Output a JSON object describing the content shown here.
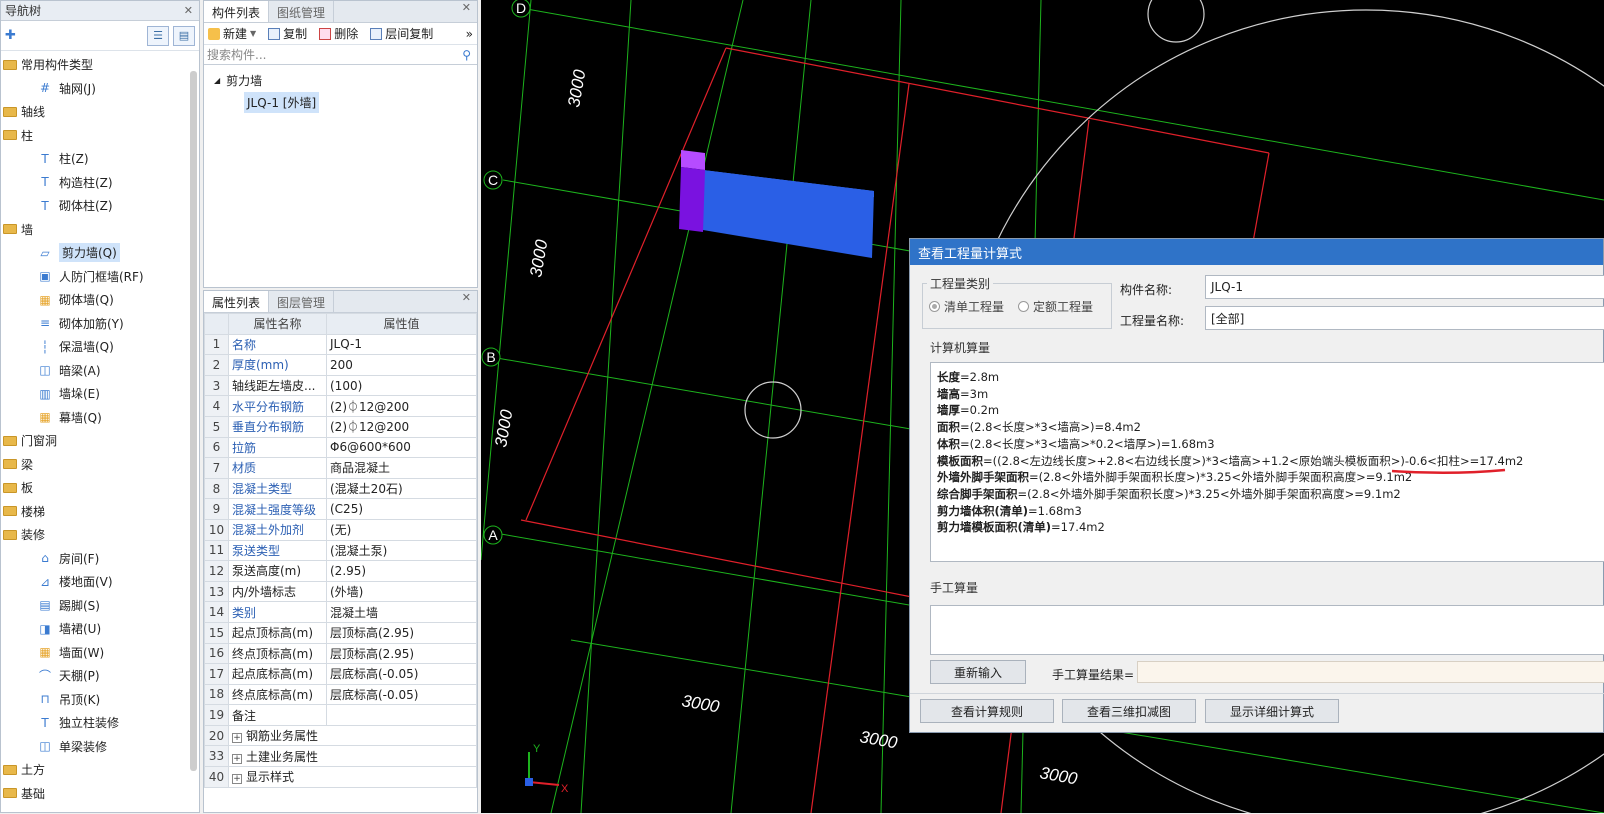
{
  "nav": {
    "title": "导航树",
    "tree": [
      {
        "label": "常用构件类型",
        "type": "group"
      },
      {
        "label": "轴网(J)",
        "type": "child",
        "icon": "grid-icon"
      },
      {
        "label": "轴线",
        "type": "group"
      },
      {
        "label": "柱",
        "type": "group"
      },
      {
        "label": "柱(Z)",
        "type": "child",
        "icon": "column-icon"
      },
      {
        "label": "构造柱(Z)",
        "type": "child",
        "icon": "column-icon"
      },
      {
        "label": "砌体柱(Z)",
        "type": "child",
        "icon": "column-icon"
      },
      {
        "label": "墙",
        "type": "group"
      },
      {
        "label": "剪力墙(Q)",
        "type": "child",
        "icon": "wall-icon",
        "selected": true
      },
      {
        "label": "人防门框墙(RF)",
        "type": "child",
        "icon": "door-icon"
      },
      {
        "label": "砌体墙(Q)",
        "type": "child",
        "icon": "brick-icon"
      },
      {
        "label": "砌体加筋(Y)",
        "type": "child",
        "icon": "rebar-icon"
      },
      {
        "label": "保温墙(Q)",
        "type": "child",
        "icon": "insulation-icon"
      },
      {
        "label": "暗梁(A)",
        "type": "child",
        "icon": "beam-icon"
      },
      {
        "label": "墙垛(E)",
        "type": "child",
        "icon": "pier-icon"
      },
      {
        "label": "幕墙(Q)",
        "type": "child",
        "icon": "curtain-icon"
      },
      {
        "label": "门窗洞",
        "type": "group"
      },
      {
        "label": "梁",
        "type": "group"
      },
      {
        "label": "板",
        "type": "group"
      },
      {
        "label": "楼梯",
        "type": "group"
      },
      {
        "label": "装修",
        "type": "group"
      },
      {
        "label": "房间(F)",
        "type": "child",
        "icon": "room-icon"
      },
      {
        "label": "楼地面(V)",
        "type": "child",
        "icon": "floor-icon"
      },
      {
        "label": "踢脚(S)",
        "type": "child",
        "icon": "skirting-icon"
      },
      {
        "label": "墙裙(U)",
        "type": "child",
        "icon": "dado-icon"
      },
      {
        "label": "墙面(W)",
        "type": "child",
        "icon": "wallface-icon"
      },
      {
        "label": "天棚(P)",
        "type": "child",
        "icon": "ceiling-icon"
      },
      {
        "label": "吊顶(K)",
        "type": "child",
        "icon": "suspended-ceiling-icon"
      },
      {
        "label": "独立柱装修",
        "type": "child",
        "icon": "column-icon"
      },
      {
        "label": "单梁装修",
        "type": "child",
        "icon": "beam-icon"
      },
      {
        "label": "土方",
        "type": "group"
      },
      {
        "label": "基础",
        "type": "group"
      }
    ]
  },
  "comp": {
    "tab1": "构件列表",
    "tab2": "图纸管理",
    "new": "新建",
    "copy": "复制",
    "delete": "删除",
    "floor_copy": "层间复制",
    "more": "»",
    "search_placeholder": "搜索构件...",
    "group": "剪力墙",
    "item": "JLQ-1 [外墙]"
  },
  "props": {
    "tab1": "属性列表",
    "tab2": "图层管理",
    "col_name": "属性名称",
    "col_value": "属性值",
    "rows": [
      {
        "n": "1",
        "name": "名称",
        "value": "JLQ-1",
        "blue": true
      },
      {
        "n": "2",
        "name": "厚度(mm)",
        "value": "200",
        "blue": true
      },
      {
        "n": "3",
        "name": "轴线距左墙皮...",
        "value": "(100)",
        "blue": false
      },
      {
        "n": "4",
        "name": "水平分布钢筋",
        "value": "(2)⏀12@200",
        "blue": true
      },
      {
        "n": "5",
        "name": "垂直分布钢筋",
        "value": "(2)⏀12@200",
        "blue": true
      },
      {
        "n": "6",
        "name": "拉筋",
        "value": "Φ6@600*600",
        "blue": true
      },
      {
        "n": "7",
        "name": "材质",
        "value": "商品混凝土",
        "blue": true
      },
      {
        "n": "8",
        "name": "混凝土类型",
        "value": "(混凝土20石)",
        "blue": true
      },
      {
        "n": "9",
        "name": "混凝土强度等级",
        "value": "(C25)",
        "blue": true
      },
      {
        "n": "10",
        "name": "混凝土外加剂",
        "value": "(无)",
        "blue": true
      },
      {
        "n": "11",
        "name": "泵送类型",
        "value": "(混凝土泵)",
        "blue": true
      },
      {
        "n": "12",
        "name": "泵送高度(m)",
        "value": "(2.95)",
        "blue": false
      },
      {
        "n": "13",
        "name": "内/外墙标志",
        "value": "(外墙)",
        "blue": false
      },
      {
        "n": "14",
        "name": "类别",
        "value": "混凝土墙",
        "blue": true
      },
      {
        "n": "15",
        "name": "起点顶标高(m)",
        "value": "层顶标高(2.95)",
        "blue": false
      },
      {
        "n": "16",
        "name": "终点顶标高(m)",
        "value": "层顶标高(2.95)",
        "blue": false
      },
      {
        "n": "17",
        "name": "起点底标高(m)",
        "value": "层底标高(-0.05)",
        "blue": false
      },
      {
        "n": "18",
        "name": "终点底标高(m)",
        "value": "层底标高(-0.05)",
        "blue": false
      },
      {
        "n": "19",
        "name": "备注",
        "value": "",
        "blue": false
      },
      {
        "n": "20",
        "name": "钢筋业务属性",
        "value": "",
        "blue": false,
        "expand": true
      },
      {
        "n": "33",
        "name": "土建业务属性",
        "value": "",
        "blue": false,
        "expand": true
      },
      {
        "n": "40",
        "name": "显示样式",
        "value": "",
        "blue": false,
        "expand": true
      }
    ]
  },
  "canvas": {
    "axis_labels": [
      "D",
      "C",
      "B",
      "A"
    ],
    "dims": [
      "3000",
      "3000",
      "3000",
      "3000",
      "3000",
      "3000"
    ],
    "axis_y": "Y",
    "axis_x": "X",
    "colors": {
      "grid": "#1db31d",
      "red": "#e0202a",
      "wall": "#2a5fe6",
      "wall_end": "#7a12e0",
      "circle": "#cfcfcf"
    }
  },
  "dialog": {
    "title": "查看工程量计算式",
    "category_label": "工程量类别",
    "radio1": "清单工程量",
    "radio2": "定额工程量",
    "comp_name_label": "构件名称:",
    "comp_name_value": "JLQ-1",
    "qty_name_label": "工程量名称:",
    "qty_name_value": "[全部]",
    "calc_label": "计算机算量",
    "lines": [
      {
        "k": "长度",
        "v": "=2.8m"
      },
      {
        "k": "墙高",
        "v": "=3m"
      },
      {
        "k": "墙厚",
        "v": "=0.2m"
      },
      {
        "k": "面积",
        "v": "=(2.8<长度>*3<墙高>)=8.4m2"
      },
      {
        "k": "体积",
        "v": "=(2.8<长度>*3<墙高>*0.2<墙厚>)=1.68m3"
      },
      {
        "k": "模板面积",
        "v": "=((2.8<左边线长度>+2.8<右边线长度>)*3<墙高>+1.2<原始端头模板面积>)-0.6<扣柱>=17.4m2"
      },
      {
        "k": "外墙外脚手架面积",
        "v": "=(2.8<外墙外脚手架面积长度>)*3.25<外墙外脚手架面积高度>=9.1m2"
      },
      {
        "k": "综合脚手架面积",
        "v": "=(2.8<外墙外脚手架面积长度>)*3.25<外墙外脚手架面积高度>=9.1m2"
      },
      {
        "k": "剪力墙体积(清单)",
        "v": "=1.68m3"
      },
      {
        "k": "剪力墙模板面积(清单)",
        "v": "=17.4m2"
      }
    ],
    "manual_label": "手工算量",
    "reinput": "重新输入",
    "manual_result_label": "手工算量结果=",
    "btn_rules": "查看计算规则",
    "btn_3d": "查看三维扣减图",
    "btn_detail": "显示详细计算式"
  }
}
